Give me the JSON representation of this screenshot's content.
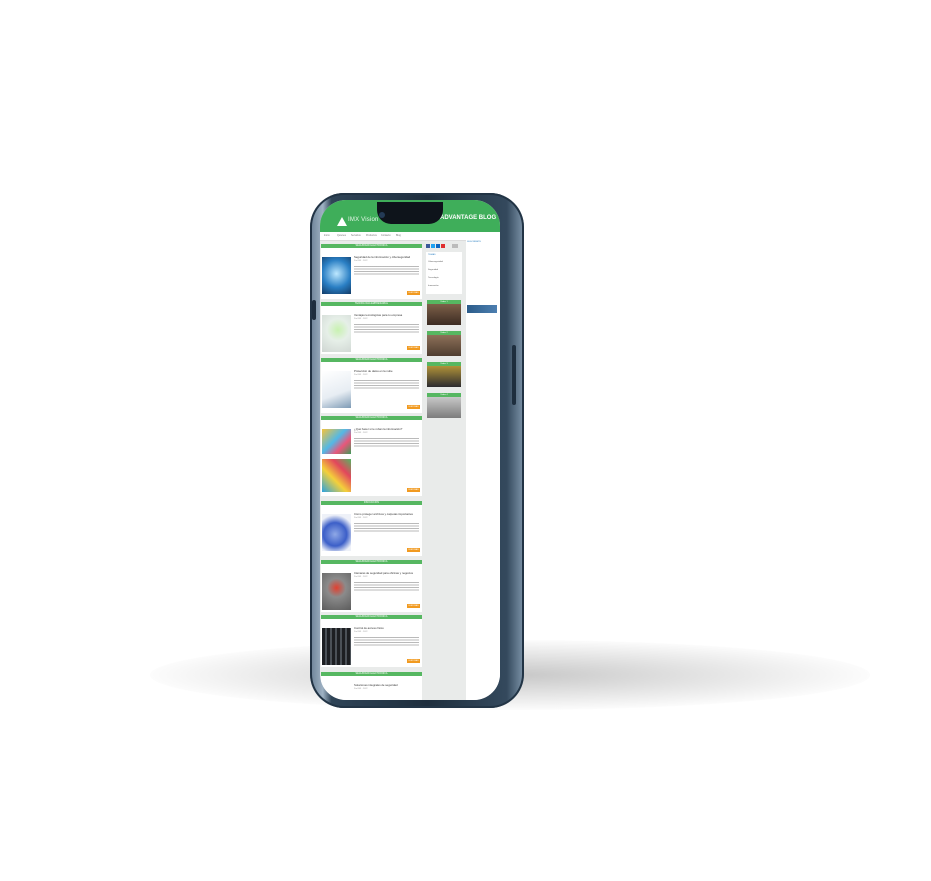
{
  "device": {
    "name": "smartphone-mockup"
  },
  "site": {
    "logo_text": "IMX Vision",
    "blog_title": "ADVANTAGE BLOG",
    "nav_items": [
      "Inicio",
      "Quienes",
      "Servicios",
      "Productos",
      "Contacto",
      "Blog"
    ]
  },
  "feed": {
    "cards": [
      {
        "category": "SEGURIDAD ELECTRÓNICA",
        "title": "Seguridad de la información y ciberseguridad",
        "meta": "Por IMX · 2022",
        "button": "LEER MÁS",
        "image": "padlock-image"
      },
      {
        "category": "TECNOLOGÍA EMPRESARIAL",
        "title": "Ventajas tecnológicas para tu empresa",
        "meta": "Por IMX · 2022",
        "button": "LEER MÁS",
        "image": "green-arrow-image"
      },
      {
        "category": "SEGURIDAD ELECTRÓNICA",
        "title": "Protección de datos en la nube",
        "meta": "Por IMX · 2022",
        "button": "LEER MÁS",
        "image": "laptop-hand-image"
      },
      {
        "category": "SEGURIDAD ELECTRÓNICA",
        "title": "¿Qué hacer si te roban la información?",
        "meta": "Por IMX · 2022",
        "button": "LEER MÁS",
        "image": "colorful-figures-image"
      },
      {
        "category": "INNOVACIÓN",
        "title": "Cómo proteger archivos y carpetas importantes",
        "meta": "Por IMX · 2022",
        "button": "LEER MÁS",
        "image": "folder-key-image"
      },
      {
        "category": "SEGURIDAD ELECTRÓNICA",
        "title": "Cámaras de seguridad para oficinas y negocios",
        "meta": "Por IMX · 2022",
        "button": "LEER MÁS",
        "image": "red-device-image"
      },
      {
        "category": "SEGURIDAD ELECTRÓNICA",
        "title": "Control de acceso físico",
        "meta": "Por IMX · 2022",
        "button": "LEER MÁS",
        "image": "server-rack-image"
      },
      {
        "category": "SEGURIDAD ELECTRÓNICA",
        "title": "Soluciones integrales de seguridad",
        "meta": "Por IMX · 2022",
        "button": "LEER MÁS",
        "image": "partial-image"
      }
    ]
  },
  "sidebar": {
    "social": [
      "facebook",
      "twitter",
      "linkedin",
      "youtube"
    ],
    "panel_title": "TEMAS",
    "topics": [
      "Ciberseguridad",
      "Seguridad",
      "Tecnología",
      "Innovación"
    ],
    "thumbs": [
      "Video 1",
      "Video 2",
      "Video 3",
      "Video 4"
    ]
  },
  "rightcol": {
    "title": "SUSCRÍBETE"
  },
  "colors": {
    "brand_green": "#3fae5a",
    "button_orange": "#f19a20",
    "frame": "#1e2e3d"
  }
}
